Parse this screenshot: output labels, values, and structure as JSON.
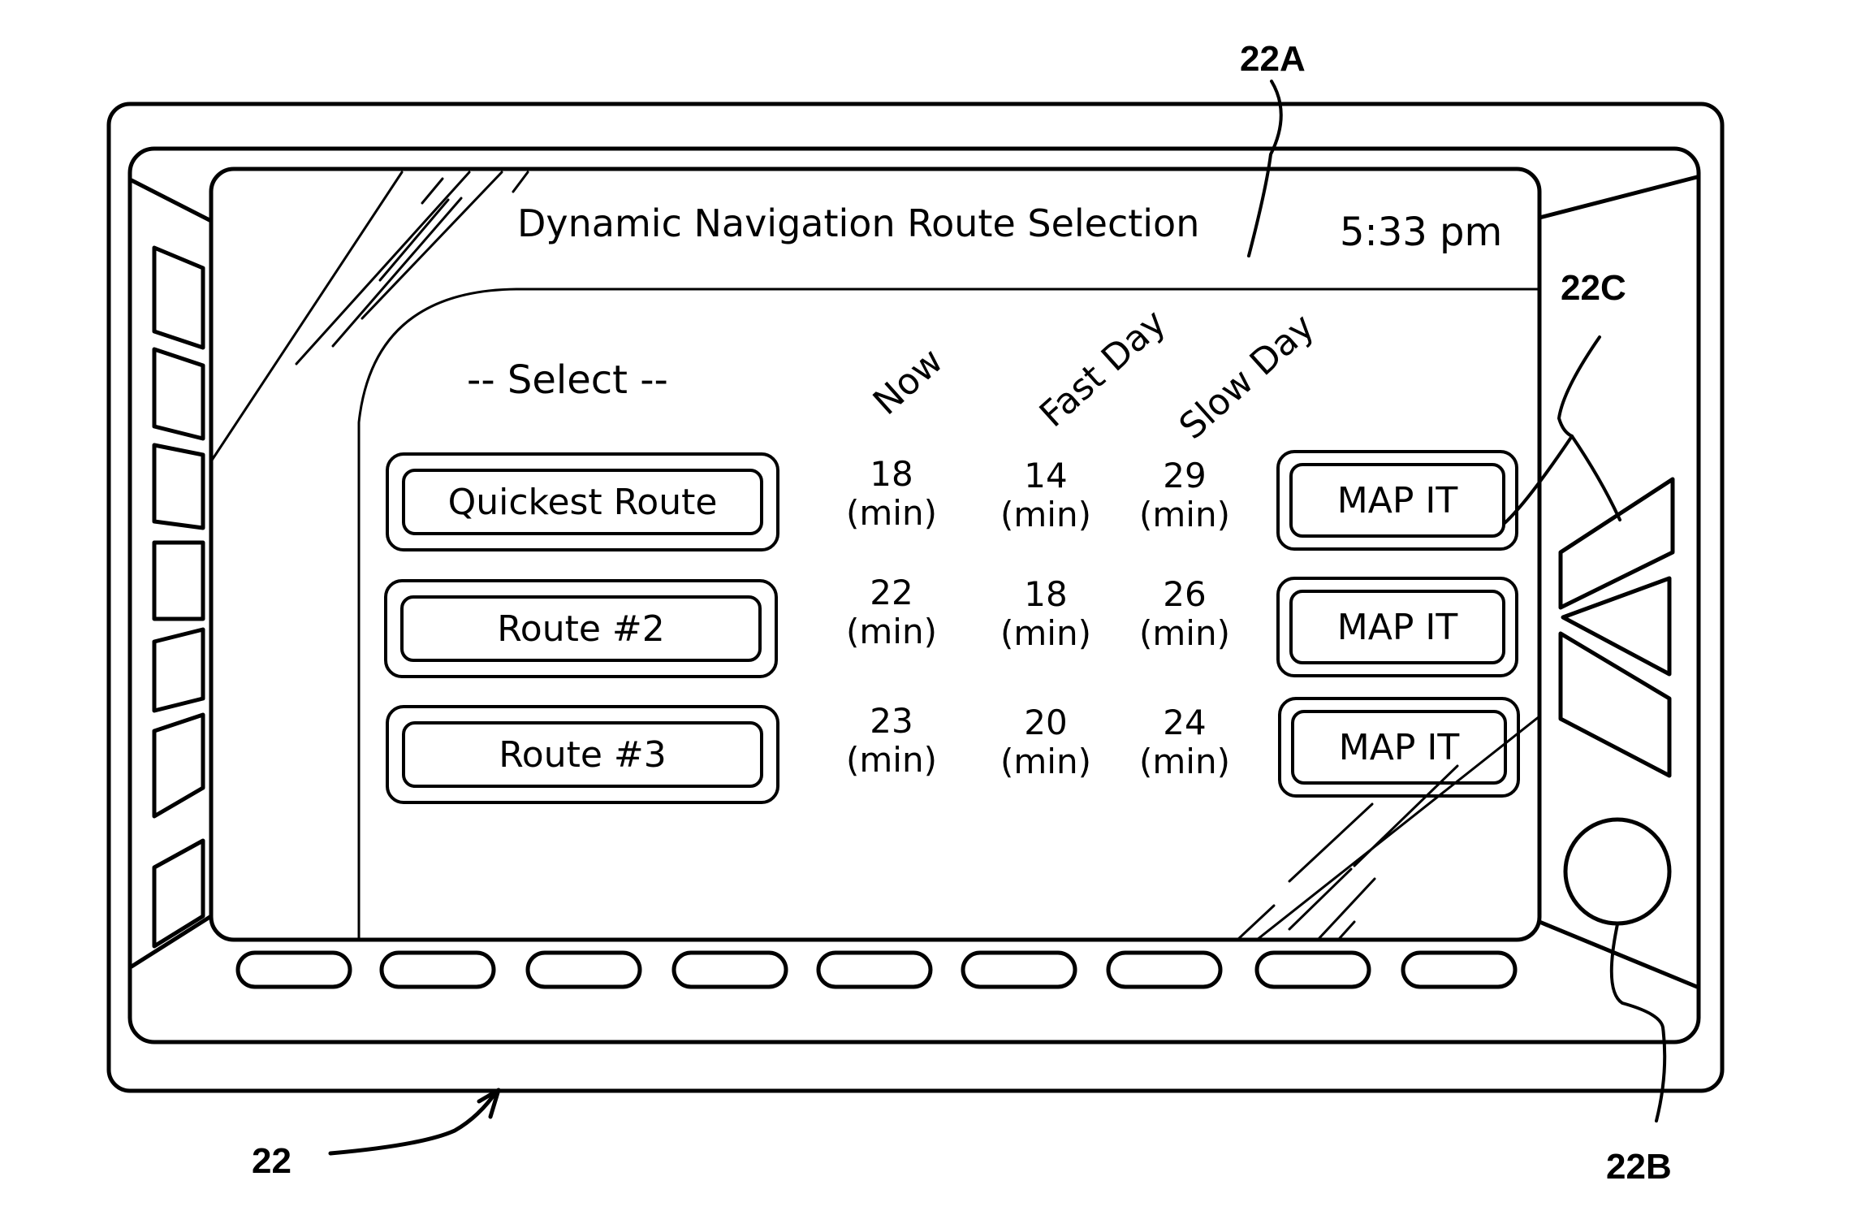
{
  "figure_labels": {
    "device": "22",
    "screen_header": "22A",
    "knob": "22B",
    "buttons": "22C"
  },
  "header": {
    "title": "Dynamic Navigation Route Selection",
    "time": "5:33 pm"
  },
  "table": {
    "select_label": "-- Select --",
    "columns": [
      "Now",
      "Fast Day",
      "Slow Day"
    ],
    "unit": "(min)",
    "rows": [
      {
        "route": "Quickest Route",
        "now": "18",
        "fast_day": "14",
        "slow_day": "29",
        "action": "MAP IT"
      },
      {
        "route": "Route #2",
        "now": "22",
        "fast_day": "18",
        "slow_day": "26",
        "action": "MAP IT"
      },
      {
        "route": "Route #3",
        "now": "23",
        "fast_day": "20",
        "slow_day": "24",
        "action": "MAP IT"
      }
    ]
  },
  "hardware": {
    "left_buttons_count": 7,
    "bottom_buttons_count": 9,
    "right_buttons": [
      "up-trapezoid-button",
      "left-triangle-button",
      "down-trapezoid-button"
    ],
    "knob": "rotary-knob"
  }
}
